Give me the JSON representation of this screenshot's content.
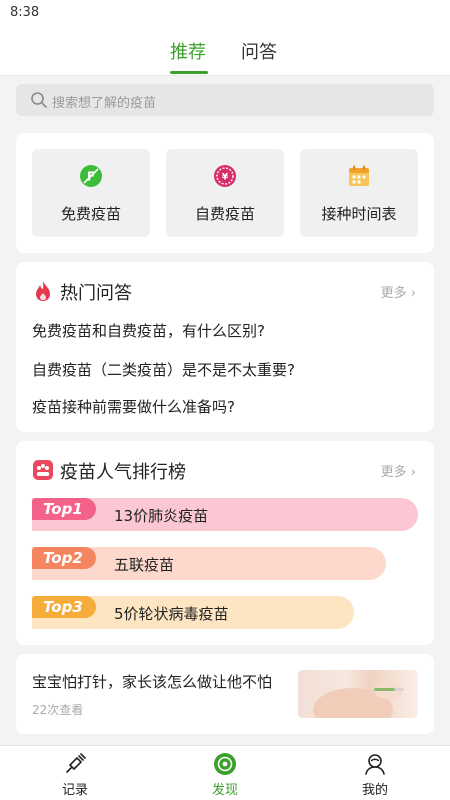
{
  "status": {
    "time": "8:38"
  },
  "tabs": [
    {
      "label": "推荐",
      "active": true
    },
    {
      "label": "问答",
      "active": false
    }
  ],
  "search": {
    "placeholder": "搜索想了解的疫苗"
  },
  "categories": [
    {
      "label": "免费疫苗",
      "icon": "free-vaccine-icon",
      "color": "#3bbd3b"
    },
    {
      "label": "自费疫苗",
      "icon": "paid-vaccine-icon",
      "color": "#d62e6a"
    },
    {
      "label": "接种时间表",
      "icon": "calendar-icon",
      "color": "#f0a22c"
    }
  ],
  "hot_qa": {
    "title": "热门问答",
    "more": "更多",
    "questions": [
      "免费疫苗和自费疫苗，有什么区别?",
      "自费疫苗（二类疫苗）是不是不太重要?",
      "疫苗接种前需要做什么准备吗?"
    ]
  },
  "ranking": {
    "title": "疫苗人气排行榜",
    "more": "更多",
    "items": [
      {
        "badge": "Top1",
        "name": "13价肺炎疫苗",
        "bar_color": "#fbc7d3",
        "badge_color": "#f4628a"
      },
      {
        "badge": "Top2",
        "name": "五联疫苗",
        "bar_color": "#fcd9cc",
        "badge_color": "#f5855f"
      },
      {
        "badge": "Top3",
        "name": "5价轮状病毒疫苗",
        "bar_color": "#fde5c2",
        "badge_color": "#f5ac3a"
      }
    ]
  },
  "article": {
    "title": "宝宝怕打针，家长该怎么做让他不怕",
    "views": "22次查看"
  },
  "bottom_nav": [
    {
      "label": "记录",
      "icon": "record-syringe-icon",
      "active": false
    },
    {
      "label": "发现",
      "icon": "discover-icon",
      "active": true
    },
    {
      "label": "我的",
      "icon": "profile-icon",
      "active": false
    }
  ],
  "colors": {
    "accent": "#3aa12a"
  }
}
